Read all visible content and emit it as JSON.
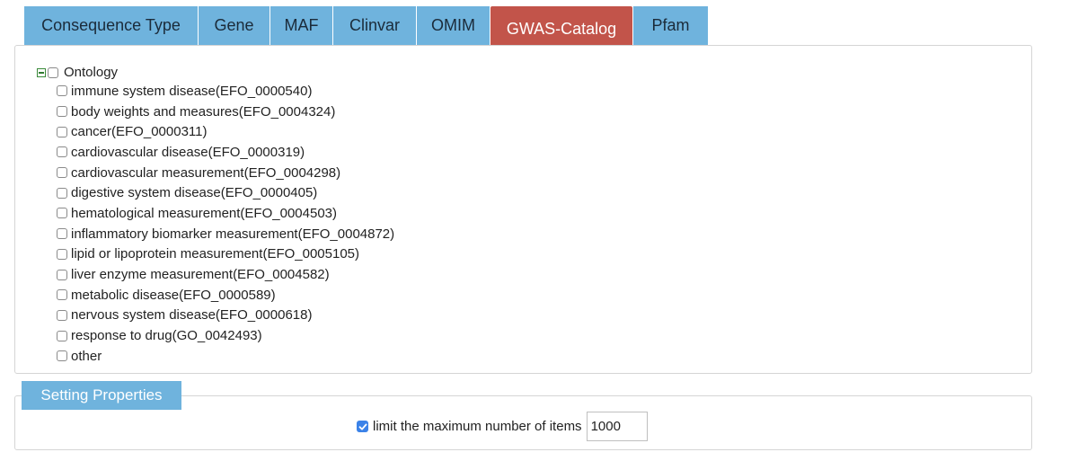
{
  "tabs": [
    {
      "label": "Consequence Type"
    },
    {
      "label": "Gene"
    },
    {
      "label": "MAF"
    },
    {
      "label": "Clinvar"
    },
    {
      "label": "OMIM"
    },
    {
      "label": "GWAS-Catalog"
    },
    {
      "label": "Pfam"
    }
  ],
  "active_tab": "GWAS-Catalog",
  "ontology": {
    "root_label": "Ontology",
    "expanded": true,
    "children": [
      {
        "label": "immune system disease(EFO_0000540)"
      },
      {
        "label": "body weights and measures(EFO_0004324)"
      },
      {
        "label": "cancer(EFO_0000311)"
      },
      {
        "label": "cardiovascular disease(EFO_0000319)"
      },
      {
        "label": "cardiovascular measurement(EFO_0004298)"
      },
      {
        "label": "digestive system disease(EFO_0000405)"
      },
      {
        "label": "hematological measurement(EFO_0004503)"
      },
      {
        "label": "inflammatory biomarker measurement(EFO_0004872)"
      },
      {
        "label": "lipid or lipoprotein measurement(EFO_0005105)"
      },
      {
        "label": "liver enzyme measurement(EFO_0004582)"
      },
      {
        "label": "metabolic disease(EFO_0000589)"
      },
      {
        "label": "nervous system disease(EFO_0000618)"
      },
      {
        "label": "response to drug(GO_0042493)"
      },
      {
        "label": "other"
      }
    ]
  },
  "settings": {
    "legend": "Setting Properties",
    "limit_label": "limit the maximum number of items",
    "limit_checked": true,
    "limit_value": "1000"
  },
  "colors": {
    "tab_bg": "#6fb3dd",
    "active_tab_bg": "#c2544a",
    "checkbox_checked": "#3b82e8"
  }
}
